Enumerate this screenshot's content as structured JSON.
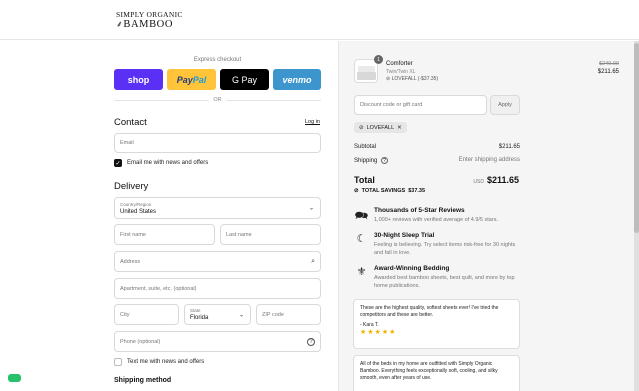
{
  "brand": {
    "line1": "SIMPLY ORGANIC",
    "line2": "BAMBOO"
  },
  "express": {
    "label": "Express checkout",
    "buttons": {
      "shop": "shop",
      "paypal_a": "Pay",
      "paypal_b": "Pal",
      "gpay": "G Pay",
      "venmo": "venmo"
    },
    "or": "OR"
  },
  "contact": {
    "heading": "Contact",
    "login": "Log in",
    "email_placeholder": "Email",
    "news_label": "Email me with news and offers"
  },
  "delivery": {
    "heading": "Delivery",
    "country_label": "Country/Region",
    "country_value": "United States",
    "first_name": "First name",
    "last_name": "Last name",
    "address": "Address",
    "apartment": "Apartment, suite, etc. (optional)",
    "city": "City",
    "state_label": "State",
    "state_value": "Florida",
    "zip": "ZIP code",
    "phone": "Phone (optional)",
    "text_news": "Text me with news and offers"
  },
  "shipping": {
    "heading": "Shipping method"
  },
  "cart": {
    "quantity": "1",
    "product_name": "Comforter",
    "variant": "Twin/Twin XL",
    "discount_note": "LOVEFALL (-$37.35)",
    "old_price": "$249.00",
    "price": "$211.65",
    "discount_placeholder": "Discount code or gift card",
    "apply": "Apply",
    "tag": "LOVEFALL",
    "subtotal_label": "Subtotal",
    "subtotal": "$211.65",
    "shipping_label": "Shipping",
    "shipping_value": "Enter shipping address",
    "total_label": "Total",
    "currency": "USD",
    "total": "$211.65",
    "savings_label": "TOTAL SAVINGS",
    "savings": "$37.35"
  },
  "features": [
    {
      "title": "Thousands of 5-Star Reviews",
      "desc": "1,000+ reviews with verified average of 4.9/5 stars."
    },
    {
      "title": "30-Night Sleep Trial",
      "desc": "Feeling is believing. Try select items risk-free for 30 nights and fall in love."
    },
    {
      "title": "Award-Winning Bedding",
      "desc": "Awarded best bamboo sheets, best quilt, and more by top home publications."
    }
  ],
  "reviews": [
    {
      "text": "These are the highest quality, softest sheets ever! I've tried the competitors and these are better.",
      "author": "- Kara T.",
      "stars": "★★★★★"
    },
    {
      "text": "All of the beds in my home are outfitted with Simply Organic Bamboo. Everything feels exceptionally soft, cooling, and silky smooth, even after years of use."
    }
  ],
  "colors": {
    "shop": "#5a31f4",
    "paypal": "#ffc439",
    "venmo": "#3d95ce",
    "chat": "#29c26a"
  }
}
